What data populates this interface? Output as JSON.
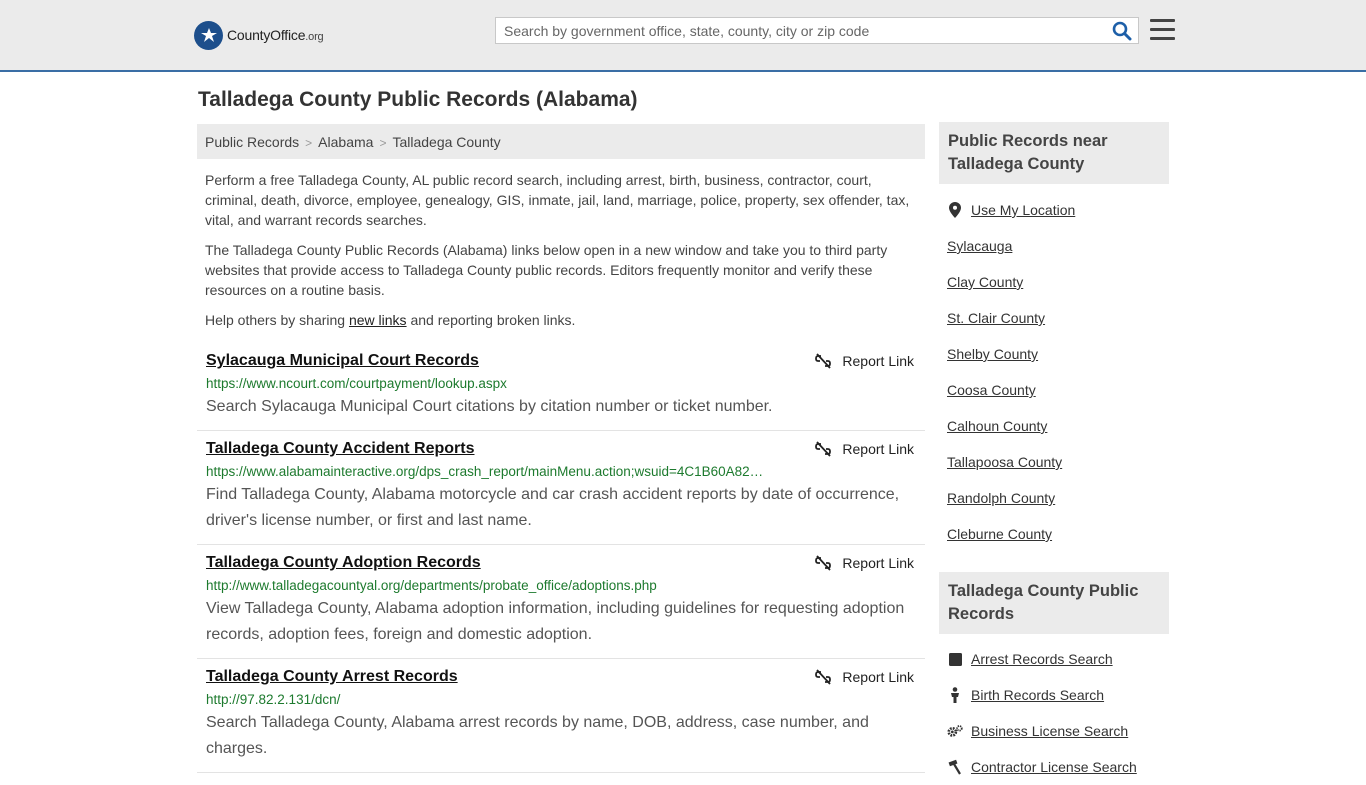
{
  "header": {
    "logo_main": "County",
    "logo_bold": "Office",
    "logo_suffix": ".org",
    "search_placeholder": "Search by government office, state, county, city or zip code"
  },
  "page": {
    "title": "Talladega County Public Records (Alabama)"
  },
  "breadcrumb": [
    "Public Records",
    "Alabama",
    "Talladega County"
  ],
  "intro": {
    "p1": "Perform a free Talladega County, AL public record search, including arrest, birth, business, contractor, court, criminal, death, divorce, employee, genealogy, GIS, inmate, jail, land, marriage, police, property, sex offender, tax, vital, and warrant records searches.",
    "p2": "The Talladega County Public Records (Alabama) links below open in a new window and take you to third party websites that provide access to Talladega County public records. Editors frequently monitor and verify these resources on a routine basis.",
    "p3_before": "Help others by sharing ",
    "p3_link": "new links",
    "p3_after": " and reporting broken links."
  },
  "report_label": "Report Link",
  "records": [
    {
      "title": "Sylacauga Municipal Court Records",
      "url": "https://www.ncourt.com/courtpayment/lookup.aspx",
      "desc": "Search Sylacauga Municipal Court citations by citation number or ticket number."
    },
    {
      "title": "Talladega County Accident Reports",
      "url": "https://www.alabamainteractive.org/dps_crash_report/mainMenu.action;wsuid=4C1B60A82…",
      "desc": "Find Talladega County, Alabama motorcycle and car crash accident reports by date of occurrence, driver's license number, or first and last name."
    },
    {
      "title": "Talladega County Adoption Records",
      "url": "http://www.talladegacountyal.org/departments/probate_office/adoptions.php",
      "desc": "View Talladega County, Alabama adoption information, including guidelines for requesting adoption records, adoption fees, foreign and domestic adoption."
    },
    {
      "title": "Talladega County Arrest Records",
      "url": "http://97.82.2.131/dcn/",
      "desc": "Search Talladega County, Alabama arrest records by name, DOB, address, case number, and charges."
    }
  ],
  "sidebar": {
    "nearby_title": "Public Records near Talladega County",
    "use_location": "Use My Location",
    "nearby": [
      "Sylacauga",
      "Clay County",
      "St. Clair County",
      "Shelby County",
      "Coosa County",
      "Calhoun County",
      "Tallapoosa County",
      "Randolph County",
      "Cleburne County"
    ],
    "county_title": "Talladega County Public Records",
    "county_links": [
      {
        "label": "Arrest Records Search",
        "icon": "square-icon"
      },
      {
        "label": "Birth Records Search",
        "icon": "person-icon"
      },
      {
        "label": "Business License Search",
        "icon": "gears-icon"
      },
      {
        "label": "Contractor License Search",
        "icon": "hammer-icon"
      }
    ]
  }
}
